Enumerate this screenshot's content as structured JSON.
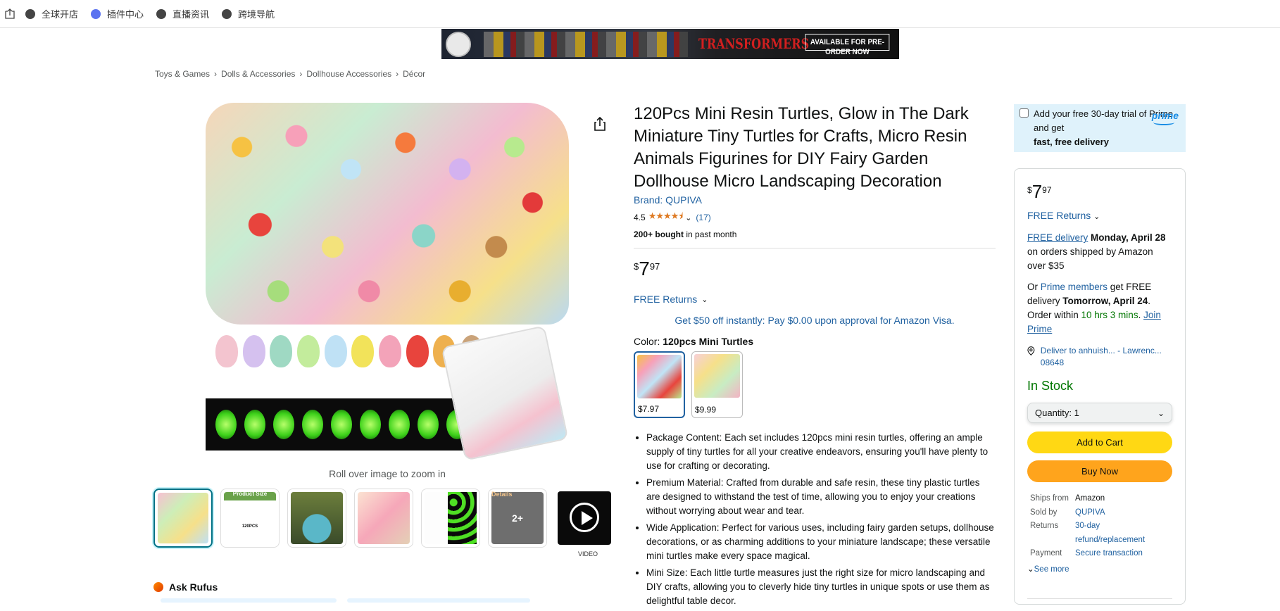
{
  "topbar": {
    "items": [
      "全球开店",
      "插件中心",
      "直播资讯",
      "跨境导航"
    ]
  },
  "banner": {
    "brand": "TRANSFORMERS",
    "cta": "AVAILABLE FOR PRE-ORDER NOW"
  },
  "breadcrumbs": [
    "Toys & Games",
    "Dolls & Accessories",
    "Dollhouse Accessories",
    "Décor"
  ],
  "gallery": {
    "zoom_hint": "Roll over image to zoom in",
    "thumb2_label": "Product Size",
    "thumb2_sub": "120PCS",
    "thumb5_label": "Details",
    "more_label": "2+",
    "video_label": "VIDEO"
  },
  "rufus": {
    "label": "Ask Rufus"
  },
  "product": {
    "title": "120Pcs Mini Resin Turtles, Glow in The Dark Miniature Tiny Turtles for Crafts, Micro Resin Animals Figurines for DIY Fairy Garden Dollhouse Micro Landscaping Decoration",
    "brand": "Brand: QUPIVA",
    "rating": "4.5",
    "stars": 4.5,
    "rating_count": "(17)",
    "bought_bold": "200+ bought",
    "bought_rest": " in past month",
    "price_symbol": "$",
    "price_whole": "7",
    "price_fraction": "97",
    "free_returns": "FREE Returns",
    "visa_offer": "Get $50 off instantly: Pay $0.00 upon approval for Amazon Visa.",
    "color_label": "Color: ",
    "color_value": "120pcs Mini Turtles",
    "swatches": [
      {
        "price": "$7.97",
        "selected": true
      },
      {
        "price": "$9.99",
        "selected": false
      }
    ],
    "bullets": [
      "Package Content: Each set includes 120pcs mini resin turtles, offering an ample supply of tiny turtles for all your creative endeavors, ensuring you'll have plenty to use for crafting or decorating.",
      "Premium Material: Crafted from durable and safe resin, these tiny plastic turtles are designed to withstand the test of time, allowing you to enjoy your creations without worrying about wear and tear.",
      "Wide Application: Perfect for various uses, including fairy garden setups, dollhouse decorations, or as charming additions to your miniature landscape; these versatile mini turtles make every space magical.",
      "Mini Size: Each little turtle measures just the right size for micro landscaping and DIY crafts, allowing you to cleverly hide tiny turtles in unique spots or use them as delightful table decor."
    ]
  },
  "prime_trial": {
    "line1": "Add your free 30-day trial of Prime and get",
    "bold": "fast, free delivery",
    "logo": "prime"
  },
  "buybox": {
    "price_symbol": "$",
    "price_whole": "7",
    "price_fraction": "97",
    "free_returns": "FREE Returns",
    "delivery_link": "FREE delivery",
    "delivery_date": "Monday, April 28",
    "delivery_rest": "on orders shipped by Amazon over $35",
    "prime_or": "Or ",
    "prime_members": "Prime members",
    "prime_get": " get FREE delivery ",
    "prime_date": "Tomorrow, April 24",
    "prime_order": ". Order within ",
    "prime_time": "10 hrs 3 mins",
    "prime_join": "Join Prime",
    "deliver_to": "Deliver to anhuish... - Lawrenc... 08648",
    "stock": "In Stock",
    "quantity_label": "Quantity:",
    "quantity_value": "1",
    "add_to_cart": "Add to Cart",
    "buy_now": "Buy Now",
    "details": [
      {
        "k": "Ships from",
        "v": "Amazon",
        "link": false
      },
      {
        "k": "Sold by",
        "v": "QUPIVA",
        "link": true
      },
      {
        "k": "Returns",
        "v": "30-day refund/replacement",
        "link": true
      },
      {
        "k": "Payment",
        "v": "Secure transaction",
        "link": true
      }
    ],
    "see_more": "See more"
  },
  "colors": {
    "link": "#2162a1",
    "stock": "#007600",
    "add_to_cart": "#ffd814",
    "buy_now": "#ffa41c",
    "prime_bg": "#dff2fb"
  }
}
